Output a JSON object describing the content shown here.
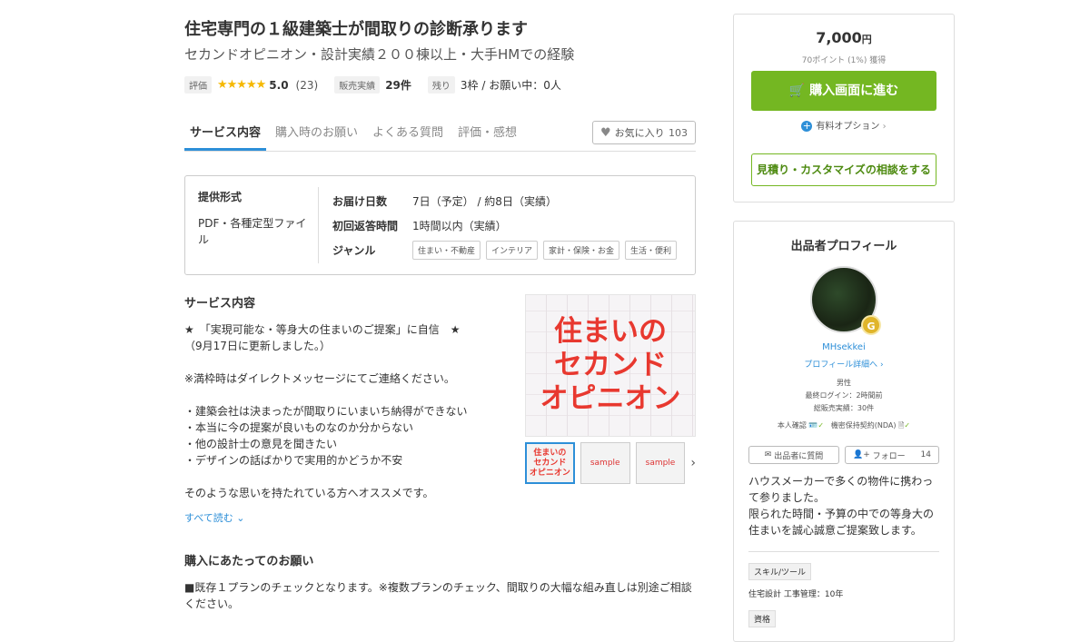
{
  "header": {
    "title": "住宅専門の１級建築士が間取りの診断承ります",
    "subtitle": "セカンドオピニオン・設計実績２００棟以上・大手HMでの経験"
  },
  "meta": {
    "rating_label": "評価",
    "stars": "★★★★★",
    "rating_score": "5.0",
    "rating_count": "(23)",
    "sales_label": "販売実績",
    "sales_value": "29件",
    "remain_label": "残り",
    "remain_value": "3枠 / お願い中：0人"
  },
  "tabs": [
    {
      "label": "サービス内容"
    },
    {
      "label": "購入時のお願い"
    },
    {
      "label": "よくある質問"
    },
    {
      "label": "評価・感想"
    }
  ],
  "favorite": {
    "label": "お気に入り",
    "count": "103"
  },
  "info": {
    "format_heading": "提供形式",
    "format_value": "PDF・各種定型ファイル",
    "delivery_label": "お届け日数",
    "delivery_value": "7日（予定） / 約8日（実績）",
    "reply_label": "初回返答時間",
    "reply_value": "1時間以内（実績）",
    "genre_label": "ジャンル",
    "genres": [
      "住まい・不動産",
      "インテリア",
      "家計・保険・お金",
      "生活・便利"
    ]
  },
  "description": {
    "heading": "サービス内容",
    "lines": [
      "★　「実現可能な・等身大の住まいのご提案」に自信　★",
      "（9月17日に更新しました。）",
      "",
      "※満枠時はダイレクトメッセージにてご連絡ください。",
      "",
      "・建築会社は決まったが間取りにいまいち納得ができない",
      "・本当に今の提案が良いものなのか分からない",
      "・他の設計士の意見を聞きたい",
      "・デザインの話ばかりで実用的かどうか不安",
      "",
      "そのような思いを持たれている方へオススメです。"
    ],
    "read_more": "すべて読む"
  },
  "gallery": {
    "main_text": [
      "住まいの",
      "セカンド",
      "オピニオン"
    ],
    "thumb1": [
      "住まいの",
      "セカンド",
      "オピニオン"
    ],
    "thumb2": "sample",
    "thumb3": "sample"
  },
  "purchase_notes": {
    "heading": "購入にあたってのお願い",
    "text": "■既存１プランのチェックとなります。※複数プランのチェック、間取りの大幅な組み直しは別途ご相談ください。"
  },
  "purchase": {
    "price": "7,000",
    "currency": "円",
    "points": "70ポイント (1%) 獲得",
    "buy_label": "購入画面に進む",
    "option_label": "有料オプション",
    "consult_label": "見積り・カスタマイズの相談をする"
  },
  "seller": {
    "heading": "出品者プロフィール",
    "badge": "G",
    "name": "MHsekkei",
    "profile_link": "プロフィール詳細へ",
    "gender": "男性",
    "last_login": "最終ログイン：2時間前",
    "total_sales": "総販売実績：30件",
    "identity": "本人確認",
    "nda": "機密保持契約(NDA)",
    "ask_label": "出品者に質問",
    "follow_label": "フォロー",
    "follow_count": "14",
    "bio": "ハウスメーカーで多くの物件に携わって参りました。\n限られた時間・予算の中での等身大の住まいを誠心誠意ご提案致します。",
    "skill_label": "スキル/ツール",
    "skill_value": "住宅設計 工事管理：10年",
    "qualification_label": "資格"
  },
  "colors": {
    "accent": "#2d8fd8",
    "buy": "#74b722",
    "star": "#f5b800",
    "red": "#e8382f"
  }
}
